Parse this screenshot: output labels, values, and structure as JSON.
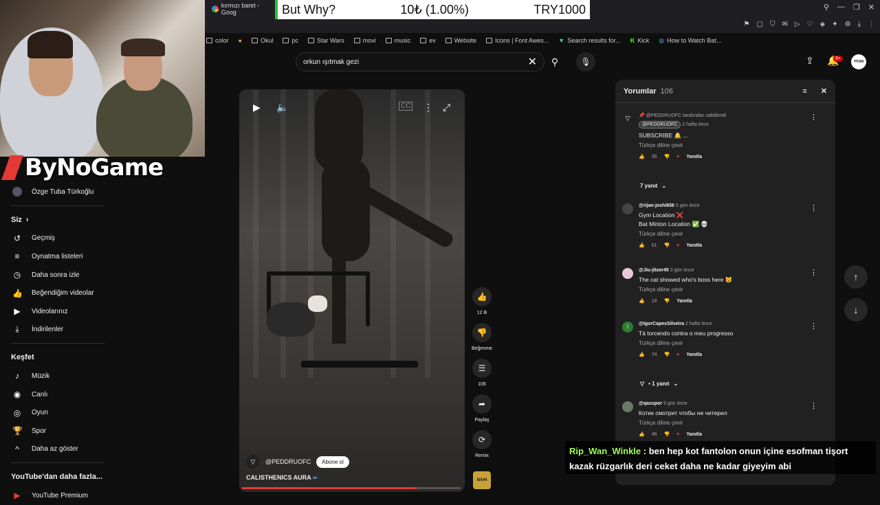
{
  "browser": {
    "tab_title": "kırmızı baret - Goog",
    "bookmarks": [
      "color",
      "Okul",
      "pc",
      "Star Wars",
      "movi",
      "music",
      "ev",
      "Website",
      "Icons | Font Awes...",
      "Search results for...",
      "Kick",
      "How to Watch Bat..."
    ]
  },
  "overlay": {
    "left": "But Why?",
    "mid": "10₺ (1.00%)",
    "right": "TRY1000"
  },
  "logo": {
    "text": "ByNoGame"
  },
  "sidebar": {
    "top_item": "Özge Tuba Türkoğlu",
    "you_heading": "Siz",
    "you_items": [
      {
        "icon": "history-icon",
        "label": "Geçmiş"
      },
      {
        "icon": "playlist-icon",
        "label": "Oynatma listeleri"
      },
      {
        "icon": "clock-icon",
        "label": "Daha sonra izle"
      },
      {
        "icon": "like-icon",
        "label": "Beğendiğim videolar"
      },
      {
        "icon": "video-icon",
        "label": "Videolarınız"
      },
      {
        "icon": "download-icon",
        "label": "İndirilenler"
      }
    ],
    "explore_heading": "Keşfet",
    "explore_items": [
      {
        "icon": "music-icon",
        "label": "Müzik"
      },
      {
        "icon": "live-icon",
        "label": "Canlı"
      },
      {
        "icon": "gaming-icon",
        "label": "Oyun"
      },
      {
        "icon": "trophy-icon",
        "label": "Spor"
      },
      {
        "icon": "chevron-up-icon",
        "label": "Daha az göster"
      }
    ],
    "more_heading": "YouTube'dan daha fazla...",
    "more_items": [
      {
        "label": "YouTube Premium"
      }
    ]
  },
  "search": {
    "value": "orkun ışıtmak gezi"
  },
  "header": {
    "notif_count": "9+",
    "avatar_text": "TITAN"
  },
  "video": {
    "channel": "@PEDDRUOFC",
    "subscribe_label": "Abone ol",
    "title": "CALISTHENICS AURA",
    "progress": 0.8
  },
  "actions": {
    "likes": "12 B",
    "dislike_label": "Beğenme",
    "comments": "106",
    "share_label": "Paylaş",
    "remix_label": "Remix",
    "remix_thumb": "NAHI"
  },
  "comments_panel": {
    "title": "Yorumlar",
    "count": "106",
    "items": [
      {
        "pinned": "@PEDDRUOFC tarafından sabitlendi",
        "author": "@PEDDRUOFC",
        "time": "2 hafta önce",
        "text": [
          "SUBSCRIBE 🔔 ..."
        ],
        "translate": "Türkçe diline çevir",
        "likes": "35",
        "reply": "Yanıtla",
        "replies": "7 yanıt"
      },
      {
        "author": "@rijan-joshi656",
        "time": "5 gün önce",
        "text": [
          "Gym Location ❌",
          "Bat Minton Location ✅ 💀"
        ],
        "translate": "Türkçe diline çevir",
        "likes": "61",
        "reply": "Yanıtla"
      },
      {
        "author": "@Jiu-jitser45",
        "time": "3 gün önce",
        "text": [
          "The cat showed who's boss here 😼"
        ],
        "translate": "Türkçe diline çevir",
        "likes": "18",
        "reply": "Yanıtla"
      },
      {
        "author": "@IgorCapesSilveira",
        "time": "2 hafta önce",
        "text": [
          "Tá torcendo contra o meu progresso"
        ],
        "translate": "Türkçe diline çevir",
        "likes": "74",
        "reply": "Yanıtla",
        "replies": "• 1 yanıt"
      },
      {
        "author": "@qasspor",
        "time": "9 gün önce",
        "text": [
          "Котик смотрит чтобы не читерил"
        ],
        "translate": "Türkçe diline çevir",
        "likes": "46",
        "reply": "Yanıtla"
      }
    ]
  },
  "chat": {
    "user": "Rip_Wan_Winkle",
    "line1": " : ben hep kot fantolon onun içine esofman tişort",
    "line2": "kazak rüzgarlık deri ceket daha ne kadar giyeyim abi"
  }
}
